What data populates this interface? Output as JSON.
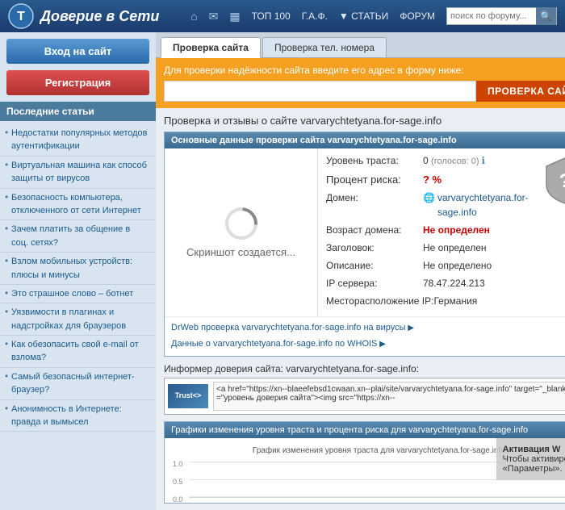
{
  "header": {
    "title": "Доверие в Сети",
    "nav": {
      "home_icon": "⌂",
      "email_icon": "✉",
      "grid_icon": "▦",
      "top100": "ТОП 100",
      "faq": "Г.А.Ф.",
      "articles": "▼ СТАТЬИ",
      "forum": "ФОРУМ",
      "search_placeholder": "поиск по форуму...",
      "search_btn": "🔍"
    }
  },
  "sidebar": {
    "login_btn": "Вход на сайт",
    "register_btn": "Регистрация",
    "articles_title": "Последние статьи",
    "articles": [
      "Недостатки популярных методов аутентификации",
      "Виртуальная машина как способ защиты от вирусов",
      "Безопасность компьютера, отключенного от сети Интернет",
      "Зачем платить за общение в соц. сетях?",
      "Взлом мобильных устройств: плюсы и минусы",
      "Это страшное слово – ботнет",
      "Уязвимости в плагинах и надстройках для браузеров",
      "Как обезопасить свой e-mail от взлома?",
      "Самый безопасный интернет-браузер?",
      "Анонимность в Интернете: правда и вымысел"
    ]
  },
  "tabs": {
    "check_site": "Проверка сайта",
    "check_phone": "Проверка тел. номера"
  },
  "check_site": {
    "label": "Для проверки надёжности сайта введите его адрес в форму ниже:",
    "url_placeholder": "",
    "check_btn": "ПРОВЕРКА САЙТА"
  },
  "results": {
    "title": "Проверка и отзывы о сайте varvarychtetyana.for-sage.info",
    "main_data_title": "Основные данные проверки сайта varvarychtetyana.for-sage.info",
    "screenshot_text": "Скриншот создается...",
    "trust_level_label": "Уровень траста:",
    "trust_level_value": "0",
    "trust_votes_text": "(голосов: 0)",
    "percent_label": "Процент риска:",
    "percent_value": "? %",
    "domain_label": "Домен:",
    "domain_value": "varvarychtetyana.for-sage.info",
    "age_label": "Возраст домена:",
    "age_value": "Не определен",
    "header_label": "Заголовок:",
    "header_value": "Не определен",
    "description_label": "Описание:",
    "description_value": "Не определено",
    "ip_label": "IP сервера:",
    "ip_value": "78.47.224.213",
    "location_label": "Месторасположение IP:",
    "location_value": "Германия",
    "drweb_link": "DrWeb проверка varvarychtetyana.for-sage.info на вирусы",
    "whois_link": "Данные о varvarychtetyana.for-sage.info по WHOIS"
  },
  "informer": {
    "title": "Информер доверия сайта: varvarychtetyana.for-sage.info:",
    "logo_text": "Trust<>",
    "code": "<a href=\"https://xn--blaeefebsd1cwaan.xn--plai/site/varvarychtetyana.for-sage.info\" target=\"_blank\" title=\"уровень доверия сайта\"><img src=\"https://xn--"
  },
  "graph": {
    "title": "Графики изменения уровня траста и процента риска для varvarychtetyana.for-sage.info",
    "inner_title": "График изменения уровня траста для varvarychtetyana.for-sage.info",
    "y_labels": [
      "1.0",
      "0.5",
      "0.0"
    ]
  },
  "activation": {
    "title": "Активация W",
    "line1": "Чтобы активиро",
    "line2": "«Параметры»."
  }
}
